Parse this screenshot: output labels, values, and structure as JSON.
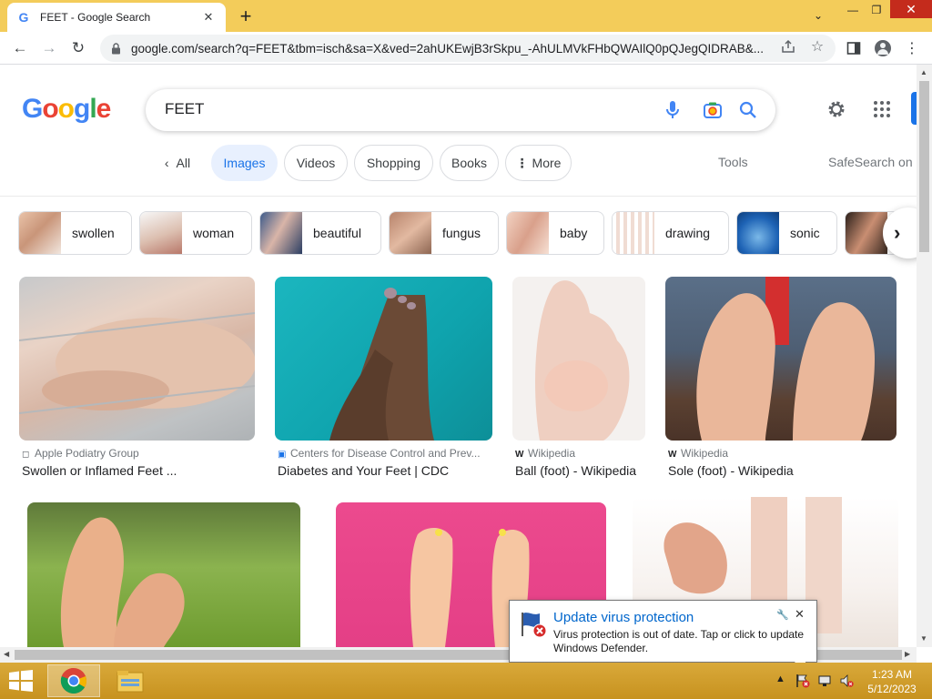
{
  "browser": {
    "tab_title": "FEET - Google Search",
    "tab_favicon": "G",
    "url": "google.com/search?q=FEET&tbm=isch&sa=X&ved=2ahUKEwjB3rSkpu_-AhULMVkFHbQWAIlQ0pQJegQIDRAB&..."
  },
  "google": {
    "logo_letters": [
      "G",
      "o",
      "o",
      "g",
      "l",
      "e"
    ],
    "logo_colors": [
      "#4285f4",
      "#ea4335",
      "#fbbc05",
      "#4285f4",
      "#34a853",
      "#ea4335"
    ],
    "query": "FEET"
  },
  "tabs": {
    "all": "All",
    "images": "Images",
    "videos": "Videos",
    "shopping": "Shopping",
    "books": "Books",
    "more": "More",
    "tools": "Tools",
    "safesearch": "SafeSearch on"
  },
  "refine_chips": [
    "swollen",
    "woman",
    "beautiful",
    "fungus",
    "baby",
    "drawing",
    "sonic"
  ],
  "results": [
    {
      "source": "Apple Podiatry Group",
      "title": "Swollen or Inflamed Feet ..."
    },
    {
      "source": "Centers for Disease Control and Prev...",
      "title": "Diabetes and Your Feet | CDC"
    },
    {
      "source": "Wikipedia",
      "title": "Ball (foot) - Wikipedia"
    },
    {
      "source": "Wikipedia",
      "title": "Sole (foot) - Wikipedia"
    }
  ],
  "notification": {
    "title": "Update virus protection",
    "body": "Virus protection is out of date. Tap or click to update Windows Defender."
  },
  "taskbar": {
    "time": "1:23 AM",
    "date": "5/12/2023"
  },
  "colors": {
    "accent": "#1a73e8",
    "chip_active_bg": "#e8f0fe",
    "taskbar": "#c7921f",
    "tabstrip": "#f3cc5a"
  }
}
